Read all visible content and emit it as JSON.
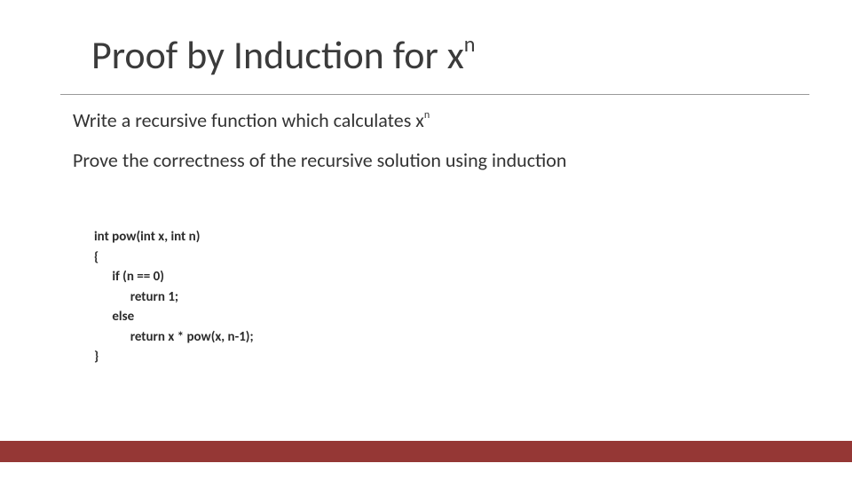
{
  "title_base": "Proof by Induction for x",
  "title_exp": "n",
  "body_line1_a": "Write a recursive function which calculates x",
  "body_line1_exp": "n",
  "body_line2": "Prove the correctness of the  recursive solution using induction",
  "code": "int pow(int x, int n)\n{\n      if (n == 0)\n            return 1;\n      else\n            return x * pow(x, n-1);\n}",
  "colors": {
    "accent_bar": "#953735"
  }
}
